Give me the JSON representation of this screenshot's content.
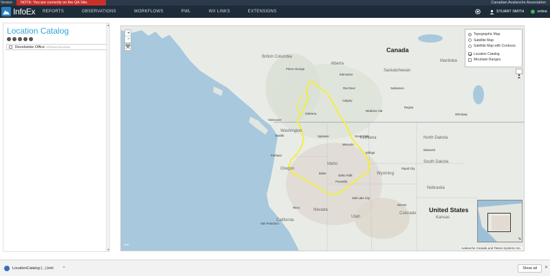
{
  "header": {
    "version_label": "Version",
    "qa_note": "NOTE: You are currently on the QA Site.",
    "org_name": "Canadian Avalanche Association",
    "logo_text": "InfoEx"
  },
  "nav": {
    "items": [
      "REPORTS",
      "OBSERVATIONS",
      "WORKFLOWS",
      "PWL",
      "WX LINKS",
      "EXTENSIONS"
    ],
    "user_name": "STUART SMITH",
    "status": "online"
  },
  "left_panel": {
    "title": "Location Catalog",
    "locations": [
      {
        "name": "Revelstoke Office",
        "type": "OPERATION AREA"
      }
    ]
  },
  "map": {
    "layers": {
      "basemaps": [
        {
          "label": "Topographic Map",
          "selected": true
        },
        {
          "label": "Satellite Map",
          "selected": false
        },
        {
          "label": "Satellite Map with Contours",
          "selected": false
        }
      ],
      "overlays": [
        {
          "label": "Location Catalog",
          "checked": true
        },
        {
          "label": "Mountain Ranges",
          "checked": false
        }
      ]
    },
    "zoom_in": "+",
    "zoom_out": "−",
    "full_extent": "⤧",
    "attribution": "Avalanche Canada and Tetera Systems Inc.",
    "esri": "esri",
    "labels": {
      "canada": "Canada",
      "united_states": "United States",
      "alberta": "Alberta",
      "british_columbia": "British Columbia",
      "saskatchewan": "Saskatchewan",
      "manitoba": "Manitoba",
      "washington": "Washington",
      "oregon": "Oregon",
      "idaho": "Idaho",
      "montana": "Montana",
      "wyoming": "Wyoming",
      "nevada": "Nevada",
      "utah": "Utah",
      "colorado": "Colorado",
      "north_dakota": "North Dakota",
      "south_dakota": "South Dakota",
      "nebraska": "Nebraska",
      "kansas": "Kansas",
      "california": "California",
      "edmonton": "Edmonton",
      "calgary": "Calgary",
      "vancouver": "Vancouver",
      "seattle": "Seattle",
      "portland": "Portland",
      "spokane": "Spokane",
      "kelowna": "Kelowna",
      "regina": "Regina",
      "saskatoon": "Saskatoon",
      "boise": "Boise",
      "salt_lake_city": "Salt Lake City",
      "denver": "Denver",
      "san_francisco": "San Francisco",
      "prince_george": "Prince George",
      "red_deer": "Red Deer",
      "medicine_hat": "Medicine Hat",
      "billings": "Billings",
      "missoula": "Missoula",
      "great_falls": "Great Falls",
      "rapid_city": "Rapid City",
      "pocatello": "Pocatello",
      "idaho_falls": "Idaho Falls",
      "reno": "Reno",
      "winnipeg": "Winnipeg",
      "bismarck": "Bismarck"
    }
  },
  "downloads": {
    "file_name": "LocationCatalog (...).kml",
    "show_all": "Show all",
    "close": "✕"
  },
  "colors": {
    "accent": "#2fa3d6",
    "navbar": "#1e2b38",
    "qa_red": "#c9302c",
    "boundary": "#f3ee3c",
    "online": "#3fb34f"
  }
}
